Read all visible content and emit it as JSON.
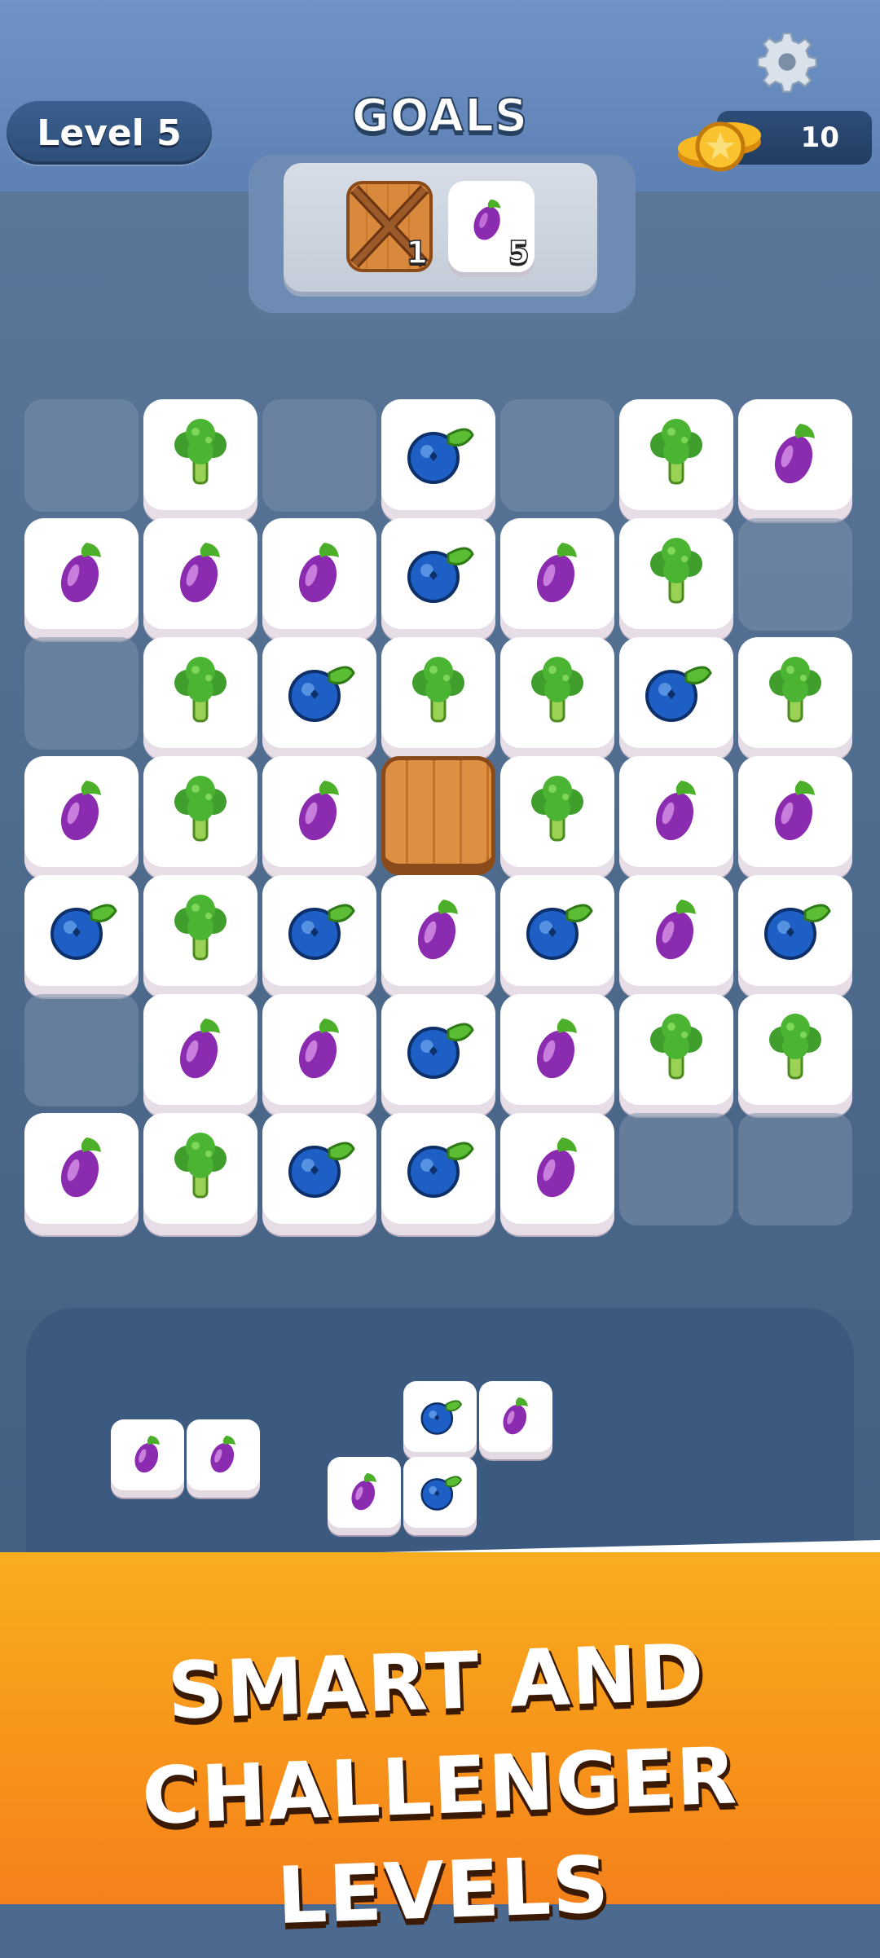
{
  "header": {
    "level_label": "Level 5",
    "goals_title": "GOALS",
    "coin_count": "10",
    "settings_icon": "gear-icon"
  },
  "goals": [
    {
      "icon": "crate-icon",
      "count": "1"
    },
    {
      "icon": "eggplant-icon",
      "count": "5"
    }
  ],
  "board": {
    "rows": [
      [
        "empty",
        "broccoli",
        "empty",
        "blueberry",
        "empty",
        "broccoli",
        "eggplant"
      ],
      [
        "eggplant",
        "eggplant",
        "eggplant",
        "blueberry",
        "eggplant",
        "broccoli",
        "empty"
      ],
      [
        "empty",
        "broccoli",
        "blueberry",
        "broccoli",
        "broccoli",
        "blueberry",
        "broccoli"
      ],
      [
        "eggplant",
        "broccoli",
        "eggplant",
        "crate",
        "broccoli",
        "eggplant",
        "eggplant"
      ],
      [
        "blueberry",
        "broccoli",
        "blueberry",
        "eggplant",
        "blueberry",
        "eggplant",
        "blueberry"
      ],
      [
        "empty",
        "eggplant",
        "eggplant",
        "blueberry",
        "eggplant",
        "broccoli",
        "broccoli"
      ],
      [
        "eggplant",
        "broccoli",
        "blueberry",
        "blueberry",
        "eggplant",
        "empty",
        "empty"
      ]
    ]
  },
  "tray": {
    "pieces": [
      {
        "name": "piece-1",
        "cells": [
          [
            "eggplant",
            "eggplant"
          ]
        ]
      },
      {
        "name": "piece-2",
        "cells": [
          [
            "empty",
            "blueberry",
            "eggplant"
          ],
          [
            "eggplant",
            "blueberry",
            "empty"
          ]
        ]
      }
    ]
  },
  "banner": {
    "line1": "SMART AND",
    "line2": "CHALLENGER LEVELS"
  },
  "colors": {
    "accent_orange": "#f7921a",
    "board_blue": "#4c6a8f"
  }
}
